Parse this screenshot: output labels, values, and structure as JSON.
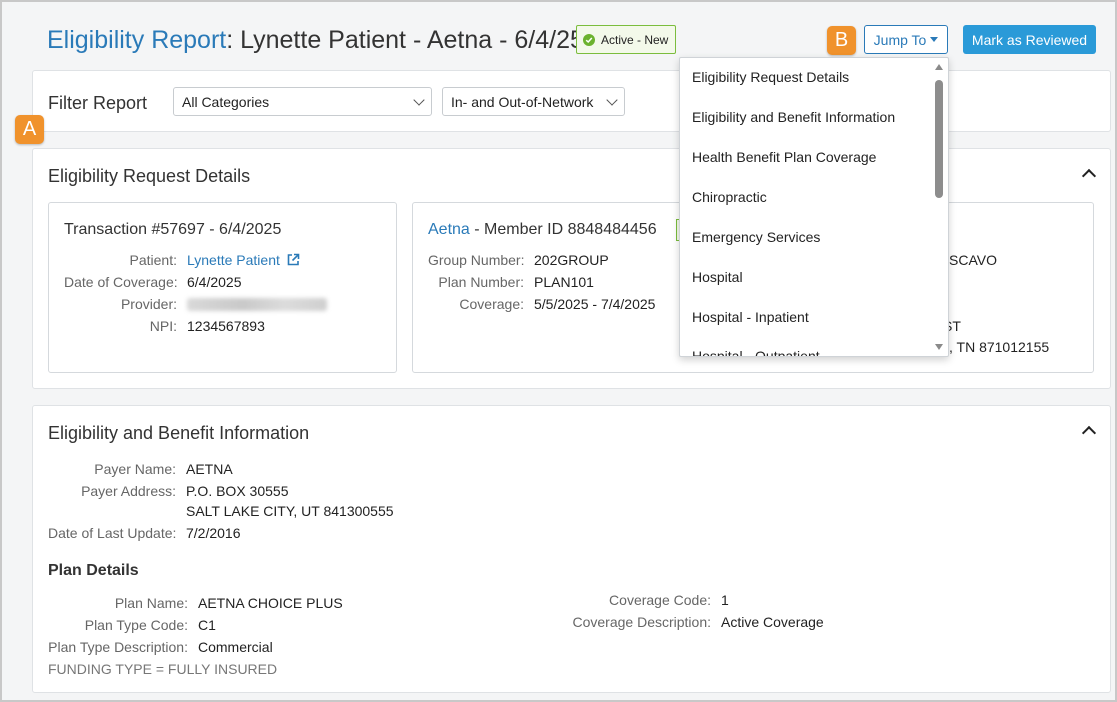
{
  "header": {
    "title_link": "Eligibility Report",
    "title_rest": ": Lynette Patient - Aetna - 6/4/25",
    "status_badge": "Active - New",
    "jump_to_label": "Jump To",
    "mark_reviewed_label": "Mark as Reviewed",
    "marker_a": "A",
    "marker_b": "B"
  },
  "filter": {
    "label": "Filter Report",
    "category_selected": "All Categories",
    "network_selected": "In- and Out-of-Network"
  },
  "eligibility_request_details": {
    "title": "Eligibility Request Details",
    "transaction_card": {
      "title": "Transaction #57697 - 6/4/2025",
      "rows": [
        {
          "key": "Patient:",
          "value": "Lynette Patient"
        },
        {
          "key": "Date of Coverage:",
          "value": "6/4/2025"
        },
        {
          "key": "Provider:",
          "value": ""
        },
        {
          "key": "NPI:",
          "value": "1234567893"
        }
      ]
    },
    "payer_card": {
      "payer": "Aetna",
      "member_id": " - Member ID 8848484456",
      "rows": [
        {
          "key": "Group Number:",
          "value": "202GROUP"
        },
        {
          "key": "Plan Number:",
          "value": "PLAN101"
        },
        {
          "key": "Coverage:",
          "value": "5/5/2025 - 7/4/2025"
        }
      ],
      "partial_right_1": "SCAVO",
      "partial_right_2": "ST",
      "partial_right_3": ", TN 871012155"
    }
  },
  "eligibility_benefit_info": {
    "title": "Eligibility and Benefit Information",
    "rows": [
      {
        "key": "Payer Name:",
        "value": "AETNA"
      },
      {
        "key": "Payer Address:",
        "value": "P.O. BOX 30555"
      },
      {
        "key": "",
        "value": "SALT LAKE CITY, UT 841300555"
      },
      {
        "key": "Date of Last Update:",
        "value": "7/2/2016"
      }
    ],
    "plan_details_title": "Plan Details",
    "plan_rows": [
      {
        "key": "Plan Name:",
        "value": "AETNA CHOICE PLUS"
      },
      {
        "key": "Plan Type Code:",
        "value": "C1"
      },
      {
        "key": "Plan Type Description:",
        "value": "Commercial"
      }
    ],
    "funding_note": "FUNDING TYPE = FULLY INSURED",
    "coverage_rows": [
      {
        "key": "Coverage Code:",
        "value": "1"
      },
      {
        "key": "Coverage Description:",
        "value": "Active Coverage"
      }
    ]
  },
  "jump_menu": {
    "items": [
      "Eligibility Request Details",
      "Eligibility and Benefit Information",
      "Health Benefit Plan Coverage",
      "Chiropractic",
      "Emergency Services",
      "Hospital",
      "Hospital - Inpatient",
      "Hospital - Outpatient"
    ]
  },
  "colors": {
    "link": "#2a7ab8",
    "primary_button": "#2a9ad8",
    "marker": "#f0922c",
    "active_badge_border": "#7bbd3d"
  }
}
